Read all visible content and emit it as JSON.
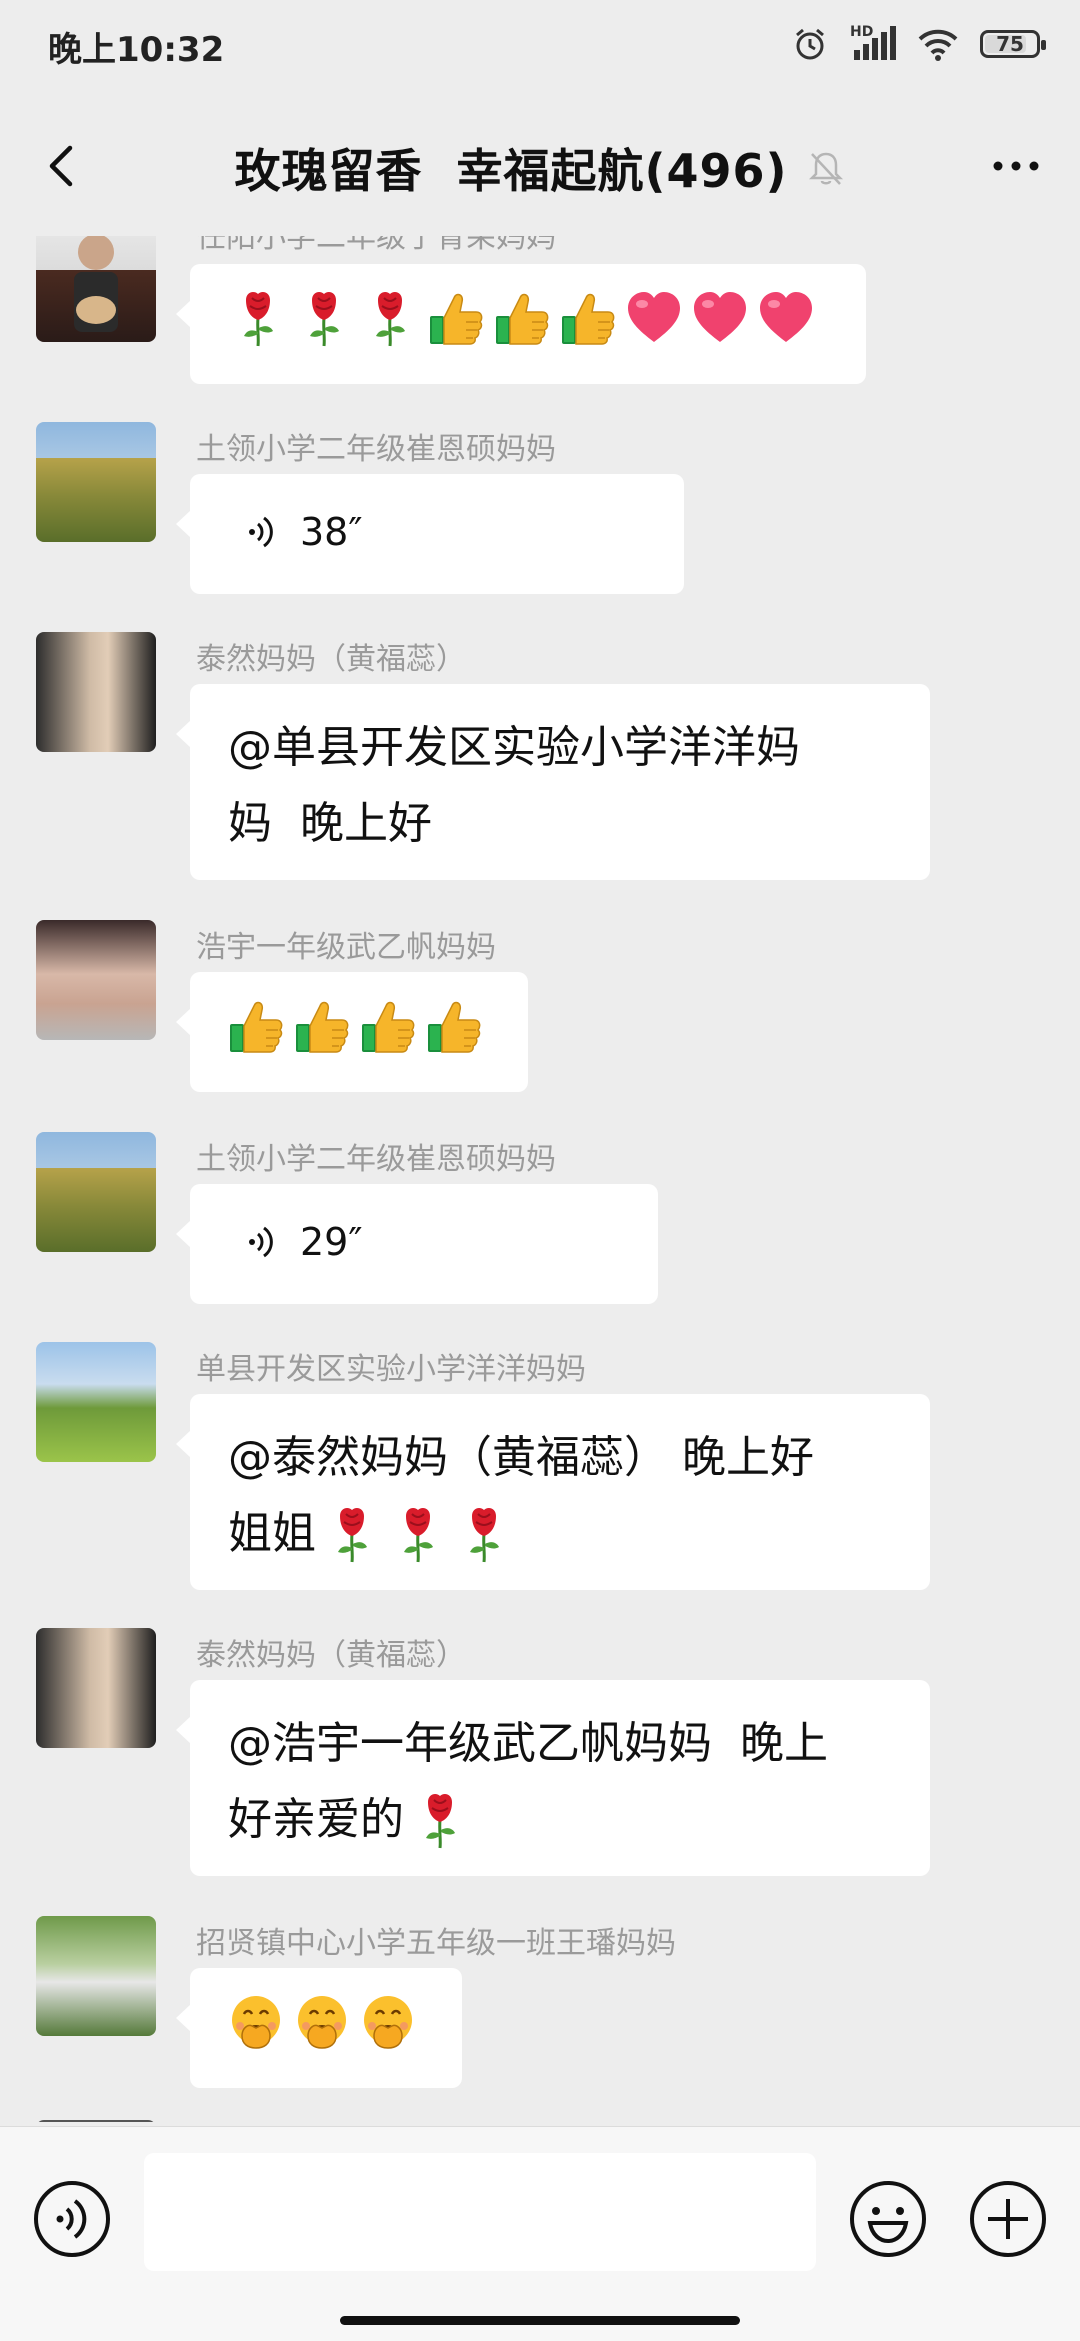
{
  "status_bar": {
    "time": "晚上10:32",
    "network_label": "HD",
    "battery_level": "75",
    "battery_percent": 75
  },
  "header": {
    "title": "玫瑰留香  幸福起航(496)",
    "back_icon": "chevron-left-icon",
    "mute_icon": "bell-muted-icon",
    "more_icon": "more-dots-icon"
  },
  "messages": [
    {
      "sender": "任阳小学二年级于青朵妈妈",
      "emojis": [
        "rose",
        "rose",
        "rose",
        "thumbs-up",
        "thumbs-up",
        "thumbs-up",
        "heart",
        "heart",
        "heart"
      ]
    },
    {
      "sender": "土领小学二年级崔恩硕妈妈",
      "voice_duration": "38″"
    },
    {
      "sender": "泰然妈妈（黄福蕊）",
      "text_line1": "@单县开发区实验小学洋洋妈",
      "text_line2": "妈  晚上好"
    },
    {
      "sender": "浩宇一年级武乙帆妈妈",
      "emojis": [
        "thumbs-up",
        "thumbs-up",
        "thumbs-up",
        "thumbs-up"
      ]
    },
    {
      "sender": "土领小学二年级崔恩硕妈妈",
      "voice_duration": "29″"
    },
    {
      "sender": "单县开发区实验小学洋洋妈妈",
      "text_line1": "@泰然妈妈（黄福蕊） 晚上好",
      "text_line2": "姐姐",
      "emojis": [
        "rose",
        "rose",
        "rose"
      ]
    },
    {
      "sender": "泰然妈妈（黄福蕊）",
      "text_line1": "@浩宇一年级武乙帆妈妈  晚上",
      "text_line2": "好亲爱的",
      "emojis": [
        "rose"
      ]
    },
    {
      "sender": "招贤镇中心小学五年级一班王璠妈妈",
      "emojis": [
        "shushing-face",
        "shushing-face",
        "shushing-face"
      ]
    }
  ],
  "input_bar": {
    "placeholder": "",
    "voice_icon": "voice-input-icon",
    "emoji_icon": "smiley-icon",
    "plus_icon": "plus-circle-icon"
  },
  "colors": {
    "background": "#ededed",
    "bubble": "#ffffff",
    "sender_name": "#9a9a9a",
    "rose": "#d91c2b",
    "thumbs": "#f6b52a",
    "heart": "#f0426e"
  }
}
